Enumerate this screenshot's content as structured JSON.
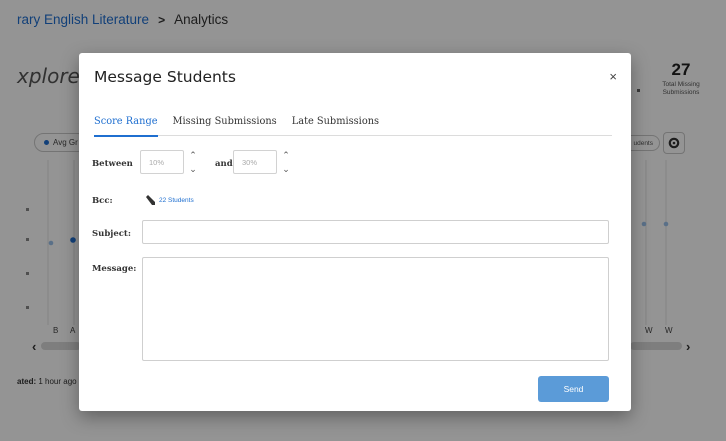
{
  "breadcrumb": {
    "parent": "rary English Literature",
    "separator": ">",
    "current": "Analytics"
  },
  "page": {
    "heading": "xplore th",
    "updated_label": "ated:",
    "updated_value": "1 hour ago"
  },
  "stats": {
    "missing_value": "27",
    "missing_label_line1": "Total Missing",
    "missing_label_line2": "Submissions"
  },
  "controls": {
    "avg_pill_label": "Avg Gr",
    "students_pill_label": "udents"
  },
  "chart_axis": {
    "left_labels": [
      "B",
      "A"
    ],
    "right_labels": [
      "W",
      "W"
    ]
  },
  "modal": {
    "title": "Message Students",
    "close_glyph": "×",
    "tabs": [
      {
        "label": "Score Range",
        "active": true
      },
      {
        "label": "Missing Submissions",
        "active": false
      },
      {
        "label": "Late Submissions",
        "active": false
      }
    ],
    "between_label": "Between",
    "min_value": "10%",
    "and_label": "and",
    "max_value": "30%",
    "bcc_label": "Bcc:",
    "bcc_link": "22 Students",
    "subject_label": "Subject:",
    "message_label": "Message:",
    "send_label": "Send"
  },
  "colors": {
    "accent": "#1f6fd0",
    "send_button": "#5b9bd8",
    "overlay": "rgba(0,0,0,0.42)"
  }
}
